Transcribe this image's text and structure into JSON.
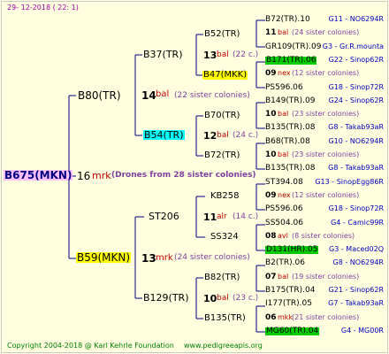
{
  "header": {
    "date": "29-  12-2018 (  22:   1)"
  },
  "root": {
    "name": "B675(MKN)",
    "gen_num": "16",
    "gen_tag": "mrk",
    "note": "(Drones from 28 sister colonies)"
  },
  "level1": [
    {
      "name": "B80(TR)",
      "num": "14",
      "tag": "bal",
      "note": "(22 sister colonies)"
    },
    {
      "name": "B59(MKN)",
      "num": "13",
      "tag": "mrk",
      "note": "(24 sister colonies)"
    }
  ],
  "level2": [
    {
      "name": "B37(TR)",
      "num": "13",
      "tag": "bal",
      "note": "(22 c.)"
    },
    {
      "name": "B54(TR)",
      "num": "12",
      "tag": "bal",
      "note": "(24 c.)"
    },
    {
      "name": "ST206",
      "num": "11",
      "tag": "alr",
      "note": "(14 c.)"
    },
    {
      "name": "B129(TR)",
      "num": "10",
      "tag": "bal",
      "note": "(23 c.)"
    }
  ],
  "level3": [
    "B52(TR)",
    "B47(MKK)",
    "B70(TR)",
    "B72(TR)",
    "KB258",
    "SS324",
    "B82(TR)",
    "B135(TR)"
  ],
  "level4": [
    {
      "name": "B72(TR).10",
      "id": "G11 - NO6294R"
    },
    {
      "name": "11",
      "tag": "bal",
      "note": "(24 sister colonies)"
    },
    {
      "name": "GR109(TR).09",
      "id": "G3 - Gr.R.mounta"
    },
    {
      "name": "B171(TR).06",
      "id": "G22 - Sinop62R"
    },
    {
      "name": "09",
      "tag": "nex",
      "note": "(12 sister colonies)"
    },
    {
      "name": "PS596.06",
      "id": "G18 - Sinop72R"
    },
    {
      "name": "B149(TR).09",
      "id": "G24 - Sinop62R"
    },
    {
      "name": "10",
      "tag": "bal",
      "note": "(23 sister colonies)"
    },
    {
      "name": "B135(TR).08",
      "id": "G8 - Takab93aR"
    },
    {
      "name": "B68(TR).08",
      "id": "G10 - NO6294R"
    },
    {
      "name": "10",
      "tag": "bal",
      "note": "(23 sister colonies)"
    },
    {
      "name": "B135(TR).08",
      "id": "G8 - Takab93aR"
    },
    {
      "name": "ST394.08",
      "id": "G13 - SinopEgg86R"
    },
    {
      "name": "09",
      "tag": "nex",
      "note": "(12 sister colonies)"
    },
    {
      "name": "PS596.06",
      "id": "G18 - Sinop72R"
    },
    {
      "name": "SS504.06",
      "id": "G4 - Camic99R"
    },
    {
      "name": "08",
      "tag": "avl",
      "note": "(8 sister colonies)"
    },
    {
      "name": "D131(HR).05",
      "id": "G3 - Maced02Q"
    },
    {
      "name": "B2(TR).06",
      "id": "G8 - NO6294R"
    },
    {
      "name": "07",
      "tag": "bal",
      "note": "(19 sister colonies)"
    },
    {
      "name": "B175(TR).04",
      "id": "G21 - Sinop62R"
    },
    {
      "name": "I177(TR).05",
      "id": "G7 - Takab93aR"
    },
    {
      "name": "06",
      "tag": "mkk",
      "note": "(21 sister colonies)"
    },
    {
      "name": "MG60(TR).04",
      "id": "G4 - MG00R"
    }
  ],
  "footer": {
    "copyright": "Copyright 2004-2018 @ Karl Kehrle Foundation",
    "url": "www.pedigreeapis.org"
  },
  "colors": {
    "background": "#FFFFE0",
    "tree_lines": "#000080",
    "num": "#000000",
    "tag": "#C00000",
    "note": "#8040A0",
    "id": "#0000C0",
    "hl_pink": "#FFC0FF",
    "hl_yellow": "#FFFF00",
    "hl_cyan": "#00FFFF",
    "hl_green": "#00CC00",
    "footer": "#008000",
    "header": "#A000A0"
  }
}
